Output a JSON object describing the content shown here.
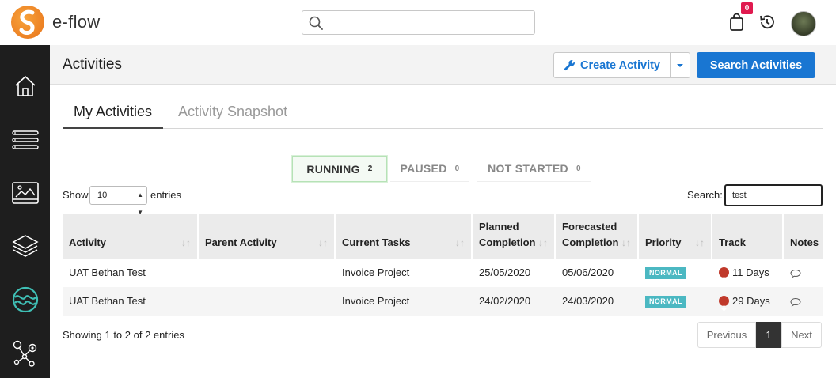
{
  "app": {
    "name": "e-flow"
  },
  "topbar": {
    "search_placeholder": "",
    "cart_count": "0"
  },
  "sidebar": {
    "items": [
      {
        "icon": "home-icon"
      },
      {
        "icon": "list-icon"
      },
      {
        "icon": "image-icon"
      },
      {
        "icon": "layers-icon"
      },
      {
        "icon": "flow-logo-icon"
      },
      {
        "icon": "network-icon"
      }
    ]
  },
  "header": {
    "title": "Activities",
    "create_label": "Create Activity",
    "search_label": "Search Activities"
  },
  "tabs": [
    {
      "label": "My Activities",
      "active": true
    },
    {
      "label": "Activity Snapshot",
      "active": false
    }
  ],
  "statuses": [
    {
      "label": "RUNNING",
      "count": "2",
      "active": true
    },
    {
      "label": "PAUSED",
      "count": "0",
      "active": false
    },
    {
      "label": "NOT STARTED",
      "count": "0",
      "active": false
    }
  ],
  "controls": {
    "show_label": "Show",
    "entries_value": "10",
    "entries_label": "entries",
    "search_label": "Search:",
    "search_value": "test"
  },
  "table": {
    "columns": [
      "Activity",
      "Parent Activity",
      "Current Tasks",
      "Planned Completion",
      "Forecasted Completion",
      "Priority",
      "Track",
      "Notes"
    ],
    "rows": [
      {
        "activity": "UAT Bethan Test",
        "parent": "",
        "task": "Invoice Project",
        "planned": "25/05/2020",
        "forecast": "05/06/2020",
        "priority": "NORMAL",
        "track": "11 Days"
      },
      {
        "activity": "UAT Bethan Test",
        "parent": "",
        "task": "Invoice Project",
        "planned": "24/02/2020",
        "forecast": "24/03/2020",
        "priority": "NORMAL",
        "track": "29 Days"
      }
    ]
  },
  "footer": {
    "showing": "Showing 1 to 2 of 2 entries",
    "prev": "Previous",
    "page": "1",
    "next": "Next"
  },
  "colors": {
    "primary": "#1976d2",
    "badge": "#4bb8c2",
    "track_down": "#c0392b",
    "sidebar_bg": "#1e1e1e",
    "cart_badge": "#e01a4f"
  }
}
